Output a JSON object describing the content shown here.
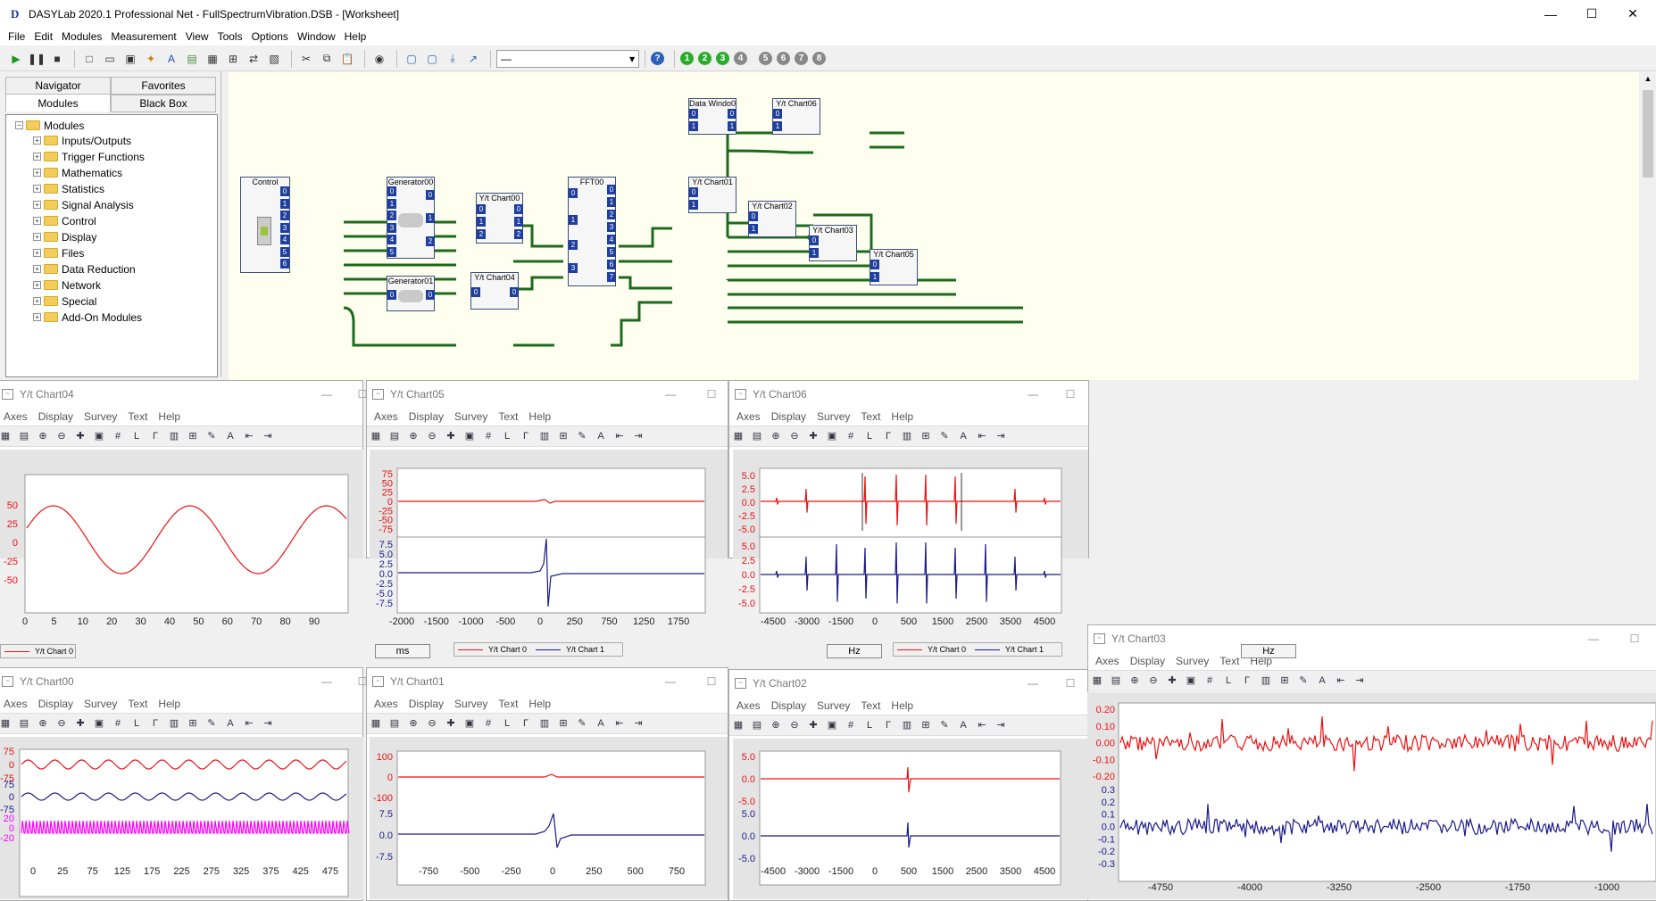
{
  "window": {
    "title": "DASYLab 2020.1 Professional Net - FullSpectrumVibration.DSB - [Worksheet]",
    "minimize": "—",
    "maximize": "☐",
    "close": "✕"
  },
  "menu": [
    "File",
    "Edit",
    "Modules",
    "Measurement",
    "View",
    "Tools",
    "Options",
    "Window",
    "Help"
  ],
  "toolbar": {
    "combo_value": "—",
    "experiment_buttons": [
      "1",
      "2",
      "3",
      "4",
      "5",
      "6",
      "7",
      "8"
    ]
  },
  "left_panel": {
    "tabs_top": [
      "Navigator",
      "Favorites"
    ],
    "tabs_bottom": [
      "Modules",
      "Black Box"
    ],
    "tree_root": "Modules",
    "tree_items": [
      "Inputs/Outputs",
      "Trigger Functions",
      "Mathematics",
      "Statistics",
      "Signal Analysis",
      "Control",
      "Display",
      "Files",
      "Data Reduction",
      "Network",
      "Special",
      "Add-On Modules"
    ]
  },
  "modules": [
    {
      "id": "control",
      "title": "Control"
    },
    {
      "id": "gen0",
      "title": "Generator00"
    },
    {
      "id": "gen1",
      "title": "Generator01"
    },
    {
      "id": "yt0",
      "title": "Y/t Chart00"
    },
    {
      "id": "yt4",
      "title": "Y/t Chart04"
    },
    {
      "id": "fft",
      "title": "FFT00"
    },
    {
      "id": "dw",
      "title": "Data Windo00"
    },
    {
      "id": "yt6",
      "title": "Y/t Chart06"
    },
    {
      "id": "yt1",
      "title": "Y/t Chart01"
    },
    {
      "id": "yt2",
      "title": "Y/t Chart02"
    },
    {
      "id": "yt3",
      "title": "Y/t Chart03"
    },
    {
      "id": "yt5",
      "title": "Y/t Chart05"
    }
  ],
  "chart_menu": [
    "Axes",
    "Display",
    "Survey",
    "Text",
    "Help"
  ],
  "charts": [
    {
      "id": "c04",
      "title": "Y/t Chart04",
      "unit": "ms",
      "legend": [
        "Y/t Chart 0"
      ],
      "yticks": [
        "50",
        "25",
        "0",
        "-25",
        "-50"
      ],
      "xticks": [
        "0",
        "5",
        "10",
        "20",
        "30",
        "40",
        "50",
        "60",
        "70",
        "80",
        "90"
      ]
    },
    {
      "id": "c05",
      "title": "Y/t Chart05",
      "unit": "Hz",
      "legend": [
        "Y/t Chart 0",
        "Y/t Chart 1"
      ],
      "yticks_top": [
        "75",
        "50",
        "25",
        "0",
        "-25",
        "-50",
        "-75"
      ],
      "yticks_bottom": [
        "7.5",
        "5.0",
        "2.5",
        "0.0",
        "-2.5",
        "-5.0",
        "-7.5"
      ],
      "xticks": [
        "-2000",
        "-1500",
        "-1000",
        "-500",
        "0",
        "250",
        "750",
        "1250",
        "1750"
      ]
    },
    {
      "id": "c06",
      "title": "Y/t Chart06",
      "unit": "Hz",
      "legend": [
        "Y/t Chart 0",
        "Y/t Chart 1"
      ],
      "yticks_top": [
        "5.0",
        "2.5",
        "0.0",
        "-2.5",
        "-5.0"
      ],
      "yticks_bottom": [
        "5.0",
        "2.5",
        "0.0",
        "-2.5",
        "-5.0"
      ],
      "xticks": [
        "-4500",
        "-3000",
        "-1500",
        "0",
        "500",
        "1500",
        "2500",
        "3500",
        "4500"
      ]
    },
    {
      "id": "c00",
      "title": "Y/t Chart00",
      "yticks_a": [
        "75",
        "0",
        "-75"
      ],
      "yticks_b": [
        "75",
        "0",
        "-75"
      ],
      "yticks_c": [
        "20",
        "0",
        "-20"
      ],
      "xticks": [
        "0",
        "25",
        "75",
        "125",
        "175",
        "225",
        "275",
        "325",
        "375",
        "425",
        "475"
      ]
    },
    {
      "id": "c01",
      "title": "Y/t Chart01",
      "yticks_top": [
        "100",
        "0",
        "-100"
      ],
      "yticks_bottom": [
        "7.5",
        "0.0",
        "-7.5"
      ],
      "xticks": [
        "-750",
        "-500",
        "-250",
        "0",
        "250",
        "500",
        "750"
      ]
    },
    {
      "id": "c02",
      "title": "Y/t Chart02",
      "yticks_top": [
        "5.0",
        "0.0",
        "-5.0"
      ],
      "yticks_bottom": [
        "5.0",
        "0.0",
        "-5.0"
      ],
      "xticks": [
        "-4500",
        "-3000",
        "-1500",
        "0",
        "500",
        "1500",
        "2500",
        "3500",
        "4500"
      ]
    },
    {
      "id": "c03",
      "title": "Y/t Chart03",
      "yticks_top": [
        "0.20",
        "0.10",
        "0.00",
        "-0.10",
        "-0.20"
      ],
      "yticks_bottom": [
        "0.3",
        "0.2",
        "0.1",
        "0.0",
        "-0.1",
        "-0.2",
        "-0.3"
      ],
      "xticks": [
        "-4750",
        "-4000",
        "-3250",
        "-2500",
        "-1750",
        "-1000"
      ]
    }
  ],
  "colors": {
    "red": "#ee1111",
    "blue": "#1a1a8c",
    "magenta": "#ff00ff",
    "port": "#1f3f9e",
    "wire": "#1c6b1c"
  }
}
